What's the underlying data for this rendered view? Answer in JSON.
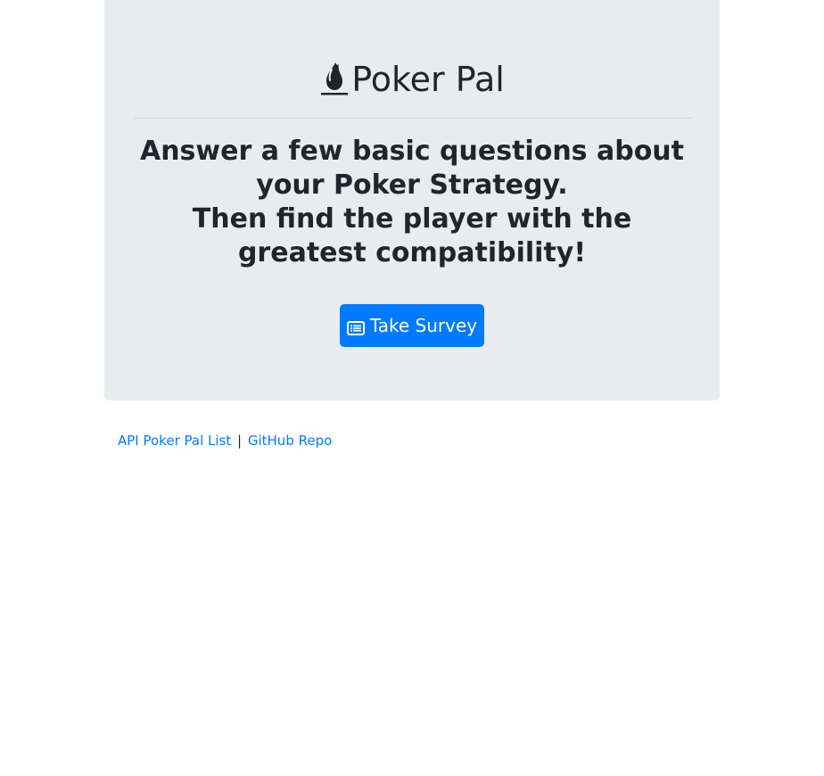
{
  "header": {
    "title": "Poker Pal",
    "logo_icon": "spade-icon"
  },
  "intro": {
    "line1": "Answer a few basic questions about your Poker Strategy.",
    "line2": "Then find the player with the greatest compatibility!"
  },
  "survey_button": {
    "icon": "list-icon",
    "label": "Take Survey"
  },
  "footer": {
    "api_link": "API Poker Pal List",
    "separator": "|",
    "github_link": "GitHub Repo"
  },
  "colors": {
    "jumbotron_bg": "#e9ecef",
    "primary": "#007bff",
    "text": "#212529"
  }
}
